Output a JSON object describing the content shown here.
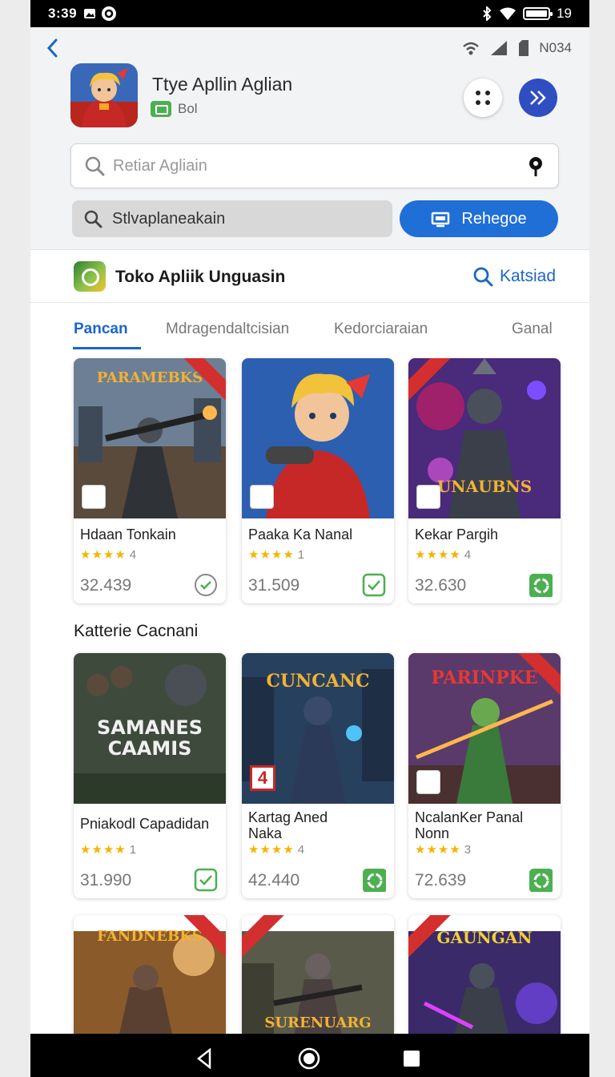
{
  "status": {
    "time": "3:39",
    "right_text": "19",
    "battery_level": 0.85
  },
  "header": {
    "network_label": "N034",
    "app_title": "Ttye Apllin Aglian",
    "app_subtitle": "Bol",
    "search_placeholder": "Retiar Agliain",
    "filter_label": "Stlvaplaneakain",
    "action_button_label": "Rehegoe"
  },
  "store": {
    "title": "Toko Apliik Unguasin",
    "search_label": "Katsiad",
    "tabs": [
      {
        "label": "Pancan",
        "active": true
      },
      {
        "label": "Mdragendaltcisian",
        "active": false
      },
      {
        "label": "Kedorciaraian",
        "active": false
      },
      {
        "label": "Ganal",
        "active": false
      }
    ]
  },
  "row1": [
    {
      "name": "Hdaan Tonkain",
      "rating": "4",
      "stars": "★★★★",
      "price": "32.439",
      "art_text": "PARAMEBKS"
    },
    {
      "name": "Paaka Ka Nanal",
      "rating": "1",
      "stars": "★★★★",
      "price": "31.509",
      "art_text": ""
    },
    {
      "name": "Kekar Pargih",
      "rating": "4",
      "stars": "★★★★",
      "price": "32.630",
      "art_text": "UNAUBNS"
    }
  ],
  "section_title": "Katterie Cacnani",
  "row2": [
    {
      "name": "Pniakodl Capadidan",
      "rating": "1",
      "stars": "★★★★",
      "price": "31.990",
      "art_text": "SAMANES CAAMIS"
    },
    {
      "name": "Kartag Aned Naka",
      "rating": "4",
      "stars": "★★★★",
      "price": "42.440",
      "art_text": "CUNCANC",
      "badge_number": "4"
    },
    {
      "name": "NcalanKer Panal Nonn",
      "rating": "3",
      "stars": "★★★★",
      "price": "72.639",
      "art_text": "PARINPKE"
    }
  ],
  "row3": [
    {
      "art_text": "FANDNEBKS"
    },
    {
      "art_text": "SURENUARG"
    },
    {
      "art_text": "GAUNGAN"
    }
  ],
  "colors": {
    "accent_blue": "#1f6fd6",
    "fab_blue": "#2f4ec2",
    "green_check": "#4caf50",
    "star": "#f5b400"
  }
}
